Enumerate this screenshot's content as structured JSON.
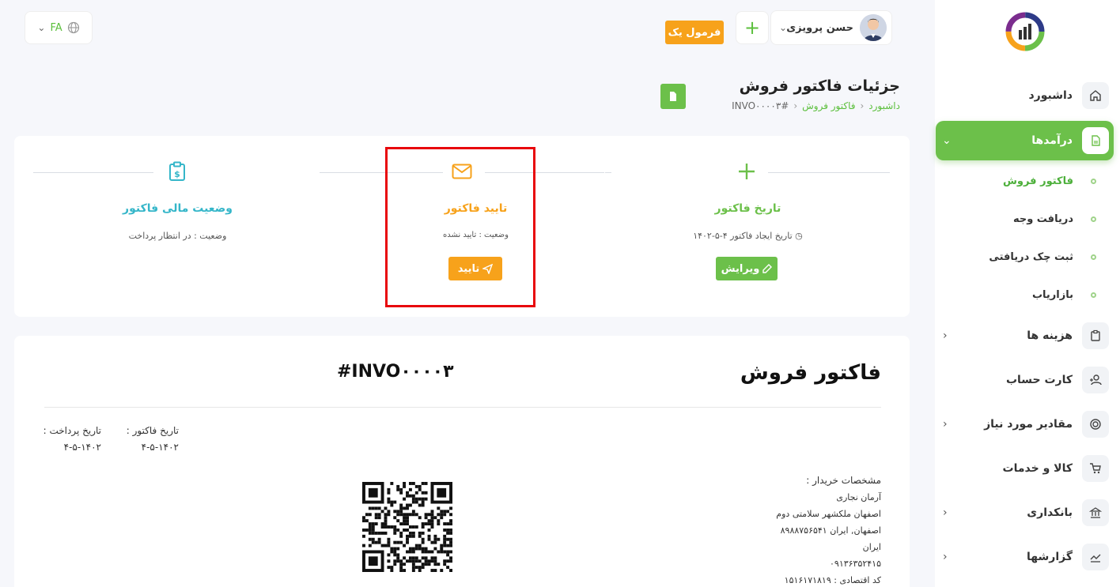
{
  "sidebar": {
    "items": [
      {
        "label": "داشبورد",
        "icon": "home-icon"
      },
      {
        "label": "درآمدها",
        "icon": "document-icon"
      },
      {
        "label": "هزینه ها",
        "icon": "clipboard-icon"
      },
      {
        "label": "کارت حساب",
        "icon": "user-plus-icon"
      },
      {
        "label": "مقادیر مورد نیاز",
        "icon": "target-icon"
      },
      {
        "label": "کالا و خدمات",
        "icon": "cart-icon"
      },
      {
        "label": "بانکداری",
        "icon": "bank-icon"
      },
      {
        "label": "گزارشها",
        "icon": "chart-icon"
      }
    ],
    "sub_items": [
      {
        "label": "فاکتور فروش"
      },
      {
        "label": "دریافت وجه"
      },
      {
        "label": "ثبت چک دریافتی"
      },
      {
        "label": "بازاریاب"
      }
    ]
  },
  "topbar": {
    "language": "FA",
    "user_name": "حسن پرویزی",
    "plus": "+",
    "formula_button": "فرمول یک"
  },
  "header": {
    "title": "جزئیات فاکتور فروش",
    "breadcrumb": [
      "داشبورد",
      "فاکتور فروش",
      "#INVO۰۰۰۰۳"
    ]
  },
  "steps": {
    "date": {
      "title": "تاریخ فاکتور",
      "sub": "تاریخ ایجاد فاکتور ۴-۵-۱۴۰۲",
      "button": "ویرایش",
      "color": "#6cc04a"
    },
    "confirm": {
      "title": "تایید فاکتور",
      "sub": "وضعیت : تایید نشده",
      "button": "تایید",
      "color": "#f7a21b"
    },
    "finance": {
      "title": "وضعیت مالی فاکتور",
      "sub": "وضعیت : در انتظار پرداخت",
      "color": "#35b6c9"
    }
  },
  "invoice": {
    "title": "فاکتور فروش",
    "number": "#INVO۰۰۰۰۳",
    "invoice_date_label": "تاریخ فاکتور :",
    "invoice_date": "۴-۵-۱۴۰۲",
    "payment_date_label": "تاریخ پرداخت :",
    "payment_date": "۴-۵-۱۴۰۲",
    "buyer_heading": "مشخصات خریدار :",
    "buyer_lines": [
      "آرمان نجاری",
      "اصفهان ملکشهر سلامتی دوم",
      "اصفهان, ایران ۸۹۸۸۷۵۶۵۴۱",
      "ایران",
      "۰۹۱۳۶۳۵۲۴۱۵",
      "کد اقتصادی : ۱۵۱۶۱۷۱۸۱۹"
    ]
  }
}
